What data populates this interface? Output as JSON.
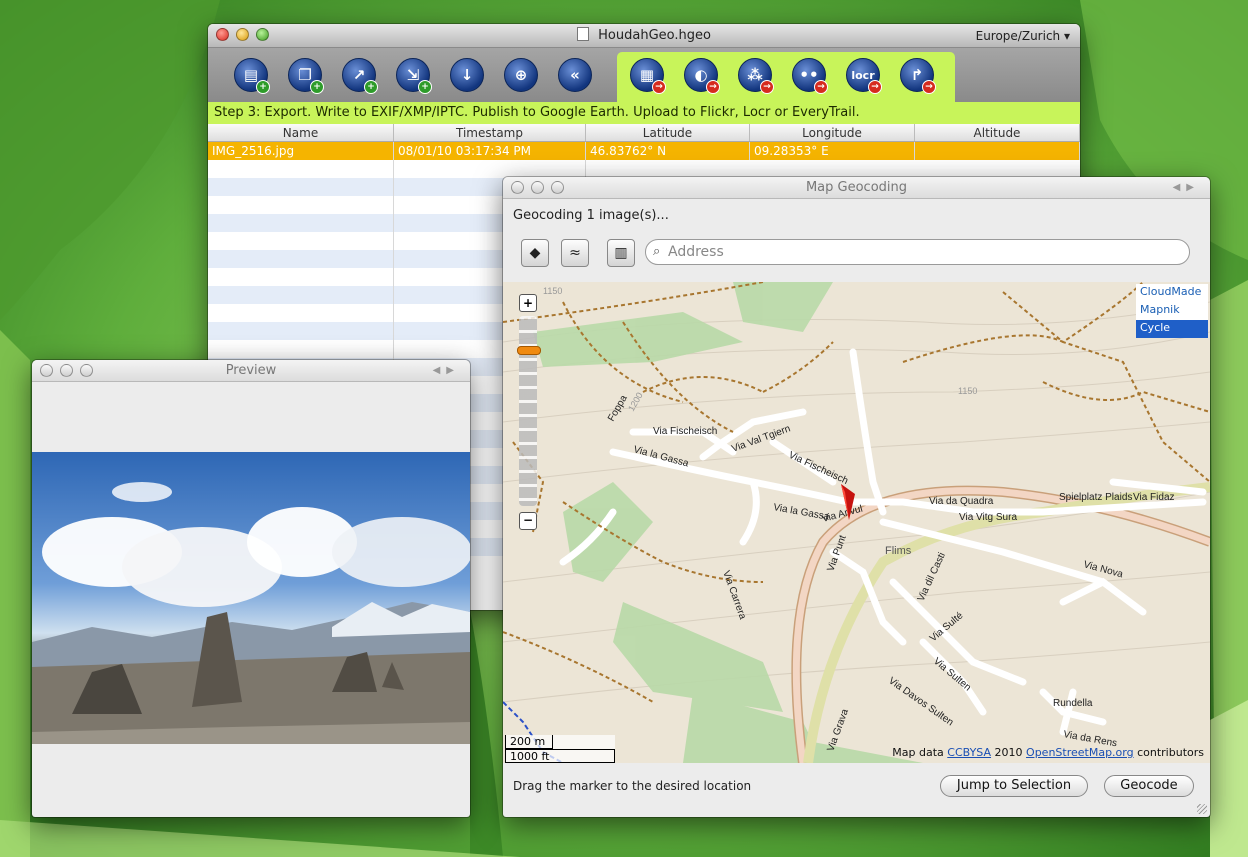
{
  "main_window": {
    "title": "HoudahGeo.hgeo",
    "timezone": "Europe/Zurich",
    "step_text": "Step 3: Export. Write to EXIF/XMP/IPTC. Publish to Google Earth. Upload to Flickr, Locr or EveryTrail.",
    "toolbar_icons": [
      "load-images-icon",
      "load-catalog-icon",
      "load-track-icon",
      "load-gps-icon",
      "download-icon",
      "geocode-target-icon",
      "rewind-icon",
      "write-exif-icon",
      "google-earth-icon",
      "flickr-upload-icon",
      "share-upload-icon",
      "locr-icon",
      "everytrail-icon"
    ],
    "locr_label": "locr",
    "columns": [
      "Name",
      "Timestamp",
      "Latitude",
      "Longitude",
      "Altitude"
    ],
    "rows": [
      {
        "name": "IMG_2516.jpg",
        "timestamp": "08/01/10 03:17:34 PM",
        "latitude": "46.83762° N",
        "longitude": "09.28353° E",
        "altitude": ""
      }
    ]
  },
  "preview_window": {
    "title": "Preview"
  },
  "map_window": {
    "title": "Map Geocoding",
    "status": "Geocoding 1 image(s)...",
    "search_placeholder": "Address",
    "layers": [
      "CloudMade",
      "Mapnik",
      "Cycle"
    ],
    "selected_layer": "Cycle",
    "streets": [
      "Via Fischeisch",
      "Via Val Tgiern",
      "Via la Gassa",
      "Via Fischeisch",
      "Via la Gassa",
      "Via Arivul",
      "Via Punt",
      "Via Carrera",
      "Flims",
      "Via da Quadra",
      "Via Vitg Sura",
      "Spielplatz Plaids",
      "Via Fidaz",
      "Via Nova",
      "Via Sulté",
      "Via dil Casti",
      "Via Sulten",
      "Via Davos Sulten",
      "Rundella",
      "Via da Rens",
      "Via Grava",
      "Foppa"
    ],
    "contours": [
      "1150",
      "1200",
      "1150"
    ],
    "attribution_prefix": "Map data",
    "attribution_license": "CCBYSA",
    "attribution_year": "2010",
    "attribution_source": "OpenStreetMap.org",
    "attribution_suffix": "contributors",
    "scale_metric": "200 m",
    "scale_imperial": "1000 ft",
    "hint": "Drag the marker to the desired location",
    "jump_button": "Jump to Selection",
    "geocode_button": "Geocode"
  }
}
